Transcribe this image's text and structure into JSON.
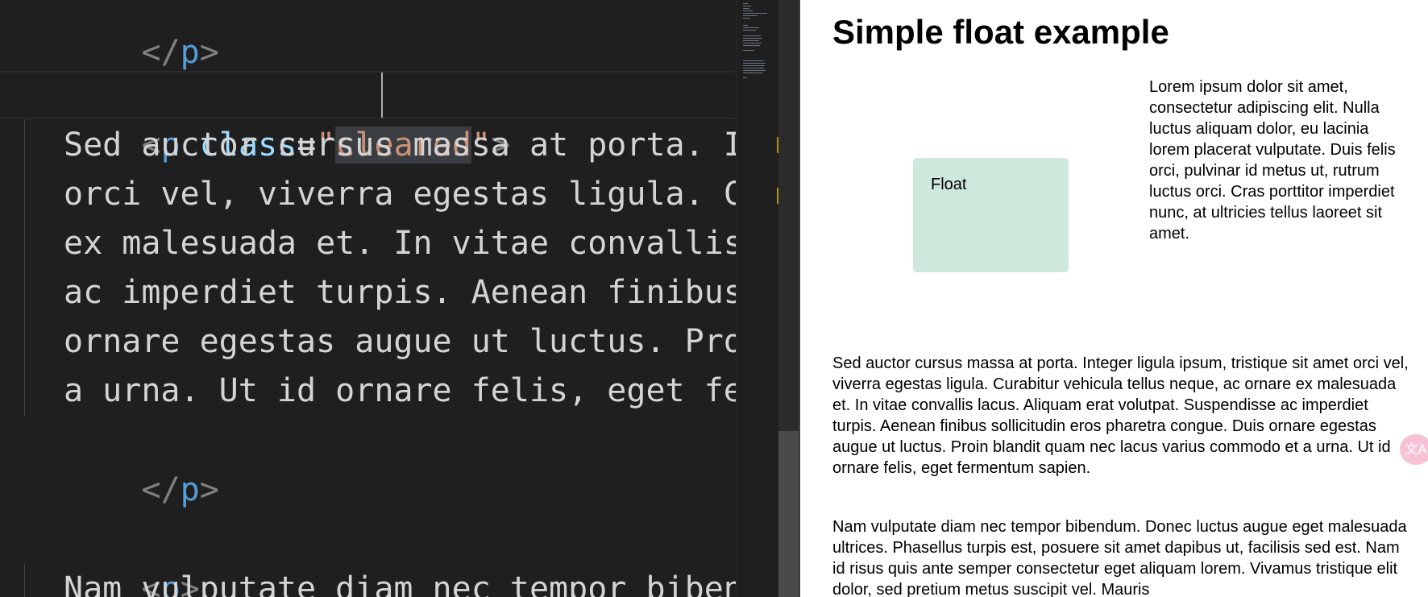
{
  "editor": {
    "lines": [
      {
        "close_open": "</",
        "close_tag": "p",
        "close_end": ">"
      },
      {
        "open": "<",
        "tag": "p",
        "attr": "class",
        "eq": "=",
        "quote_open": "\"",
        "value": "cleared",
        "quote_close": "\"",
        "end": ">"
      },
      {
        "text": "Sed auctor cursus massa at porta. Integer ligula ipsum,"
      },
      {
        "text": "orci vel, viverra egestas ligula. Curabitur vehicula"
      },
      {
        "text": "ex malesuada et. In vitae convallis lacus. Aliquam"
      },
      {
        "text": "ac imperdiet turpis. Aenean finibus sollicitudin"
      },
      {
        "text": "ornare egestas augue ut luctus. Proin blandit"
      },
      {
        "text": "a urna. Ut id ornare felis, eget fermentum"
      },
      {
        "close_open": "</",
        "close_tag": "p",
        "close_end": ">"
      },
      {
        "open": "<",
        "tag": "p",
        "end": ">"
      },
      {
        "text": "Nam vulputate diam nec tempor bibendum."
      }
    ]
  },
  "preview": {
    "title": "Simple float example",
    "float_label": "Float",
    "float_paragraph": "Lorem ipsum dolor sit amet, consectetur adipiscing elit. Nulla luctus aliquam dolor, eu lacinia lorem placerat vulputate. Duis felis orci, pulvinar id metus ut, rutrum luctus orci. Cras porttitor imperdiet nunc, at ultricies tellus laoreet sit amet.",
    "cleared_paragraph": "Sed auctor cursus massa at porta. Integer ligula ipsum, tristique sit amet orci vel, viverra egestas ligula. Curabitur vehicula tellus neque, ac ornare ex malesuada et. In vitae convallis lacus. Aliquam erat volutpat. Suspendisse ac imperdiet turpis. Aenean finibus sollicitudin eros pharetra congue. Duis ornare egestas augue ut luctus. Proin blandit quam nec lacus varius commodo et a urna. Ut id ornare felis, eget fermentum sapien.",
    "next_paragraph": "Nam vulputate diam nec tempor bibendum. Donec luctus augue eget malesuada ultrices. Phasellus turpis est, posuere sit amet dapibus ut, facilisis sed est. Nam id risus quis ante semper consectetur eget aliquam lorem. Vivamus tristique elit dolor, sed pretium metus suscipit vel. Mauris"
  },
  "translate_button": {
    "icon": "translate-icon",
    "glyph": "文A"
  },
  "colors": {
    "editor_bg": "#1f1f1f",
    "tag": "#569cd6",
    "attr": "#9cdcfe",
    "string": "#ce9178",
    "float_bg": "#cfe8dc"
  }
}
